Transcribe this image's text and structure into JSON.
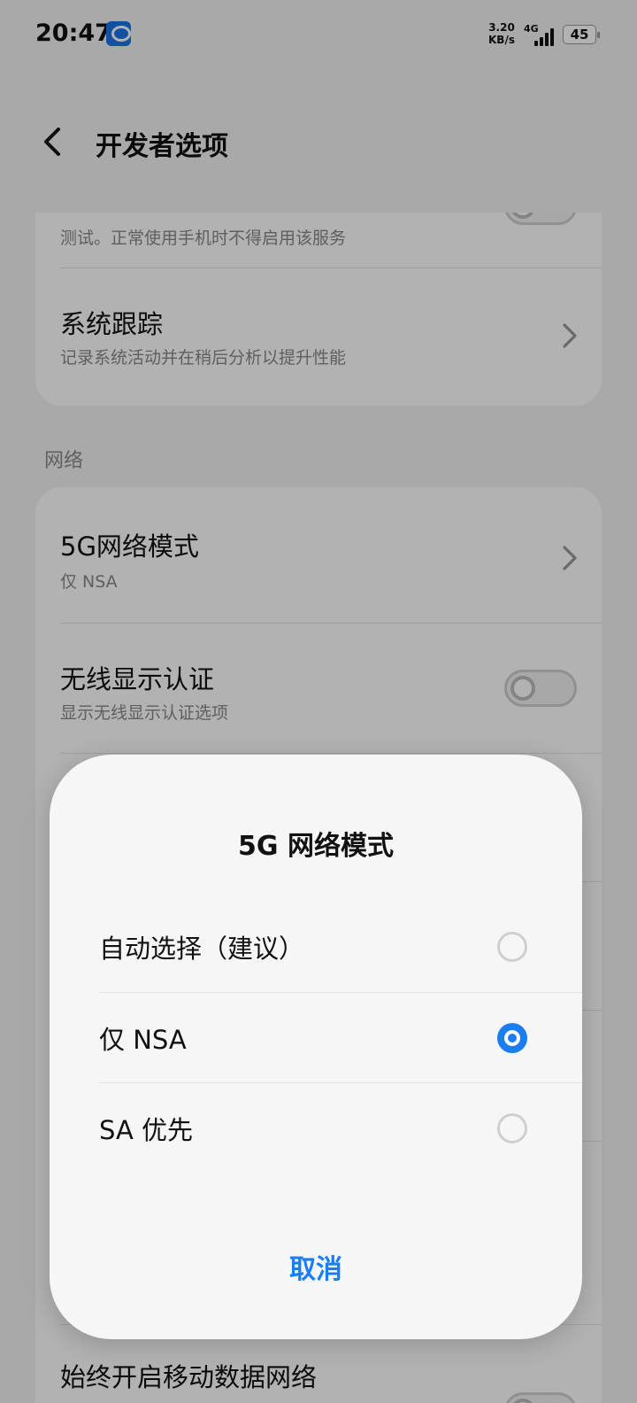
{
  "status_bar": {
    "time": "20:47",
    "net_speed_value": "3.20",
    "net_speed_unit": "KB/s",
    "network_type": "4G",
    "battery": "45"
  },
  "app_bar": {
    "title": "开发者选项"
  },
  "settings": {
    "card1": {
      "mock_modem_sub": "测试。正常使用手机时不得启用该服务",
      "system_trace_title": "系统跟踪",
      "system_trace_sub": "记录系统活动并在稍后分析以提升性能"
    },
    "network_section_label": "网络",
    "network_card": {
      "nr_mode_title": "5G网络模式",
      "nr_mode_value": "仅 NSA",
      "wireless_display_title": "无线显示认证",
      "wireless_display_sub": "显示无线显示认证选项",
      "mobile_data_always_on_title": "始终开启移动数据网络"
    }
  },
  "dialog": {
    "title": "5G 网络模式",
    "options": [
      {
        "label": "自动选择（建议）",
        "selected": false
      },
      {
        "label": "仅 NSA",
        "selected": true
      },
      {
        "label": "SA 优先",
        "selected": false
      }
    ],
    "cancel_label": "取消"
  },
  "colors": {
    "accent": "#1a7ef0",
    "background": "#f3f3f3",
    "card": "#ffffff"
  }
}
